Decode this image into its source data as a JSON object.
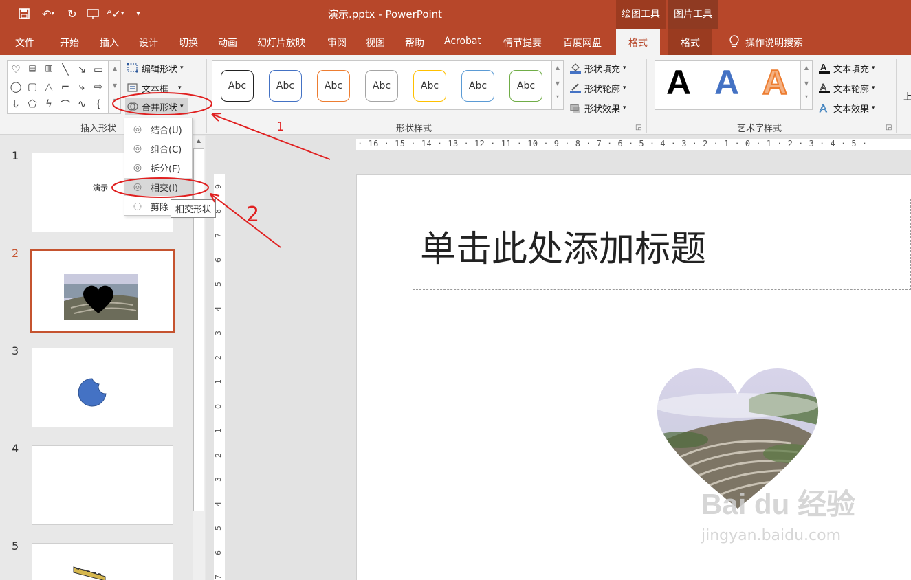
{
  "app": {
    "title": "演示.pptx  -  PowerPoint",
    "accent": "#b7472a"
  },
  "quick_access": [
    "save-icon",
    "undo-icon",
    "redo-icon",
    "slideshow-icon",
    "spellcheck-icon",
    "customize-icon"
  ],
  "context_groups": {
    "drawing_tools": "绘图工具",
    "picture_tools": "图片工具"
  },
  "tabs": [
    "文件",
    "开始",
    "插入",
    "设计",
    "切换",
    "动画",
    "幻灯片放映",
    "审阅",
    "视图",
    "帮助",
    "Acrobat",
    "情节提要",
    "百度网盘",
    "格式",
    "格式"
  ],
  "active_tab": "格式",
  "search": {
    "label": "操作说明搜索",
    "icon": "lightbulb-icon"
  },
  "ribbon": {
    "insert_shapes": {
      "label": "插入形状",
      "edit_shape": "编辑形状",
      "text_box": "文本框",
      "merge_shapes": "合并形状"
    },
    "shape_styles": {
      "label": "形状样式",
      "preview_text": "Abc",
      "previews": [
        "#222222",
        "#4472c4",
        "#ed7d31",
        "#a5a5a5",
        "#ffc000",
        "#5b9bd5",
        "#70ad47"
      ],
      "fill": "形状填充",
      "outline": "形状轮廓",
      "effects": "形状效果"
    },
    "wordart": {
      "label": "艺术字样式",
      "letters": [
        "A",
        "A",
        "A"
      ],
      "text_fill": "文本填充",
      "text_outline": "文本轮廓",
      "text_effects": "文本效果"
    },
    "overflow": "上"
  },
  "merge_menu": {
    "items": [
      "结合(U)",
      "组合(C)",
      "拆分(F)",
      "相交(I)",
      "剪除"
    ],
    "tooltip": "相交形状"
  },
  "annotations": {
    "one": "1",
    "two": "2"
  },
  "slides": [
    {
      "number": "1",
      "text": "演示"
    },
    {
      "number": "2"
    },
    {
      "number": "3"
    },
    {
      "number": "4"
    },
    {
      "number": "5"
    }
  ],
  "ruler": {
    "horizontal": "· 16 · 15 · 14 · 13 · 12 · 11 · 10 · 9 · 8 · 7 · 6 · 5 · 4 · 3 · 2 · 1 · 0 · 1 · 2 · 3 · 4 · 5 ·",
    "vertical": [
      "9",
      "8",
      "7",
      "6",
      "5",
      "4",
      "3",
      "2",
      "1",
      "0",
      "1",
      "2",
      "3",
      "4",
      "5",
      "6",
      "7"
    ]
  },
  "slide": {
    "title_placeholder": "单击此处添加标题"
  },
  "watermark": {
    "brand": "Bai du 经验",
    "url": "jingyan.baidu.com"
  }
}
